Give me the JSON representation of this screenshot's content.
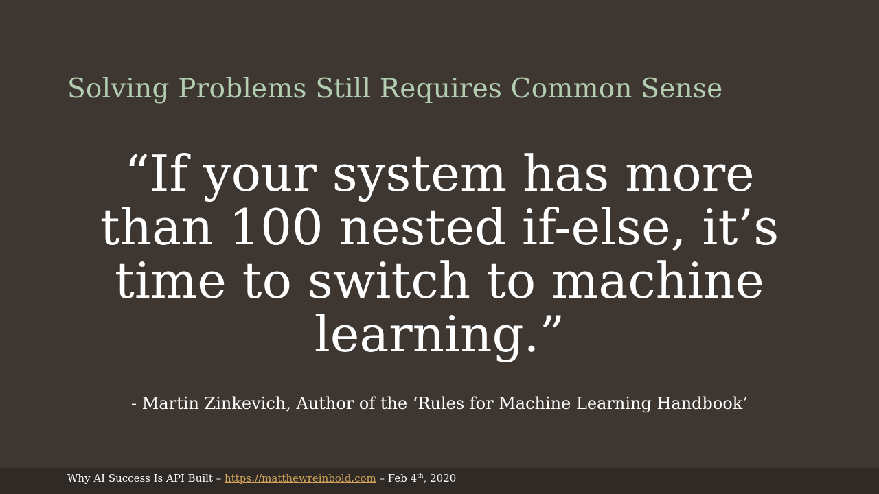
{
  "slide": {
    "title": "Solving Problems Still Requires Common Sense",
    "quote": "“If your system has more than 100 nested if-else, it’s time to switch to machine learning.”",
    "attribution": "- Martin Zinkevich, Author of the ‘Rules for Machine Learning Handbook’"
  },
  "footer": {
    "prefix": "Why AI Success  Is API Built – ",
    "link_text": "https://matthewreinbold.com",
    "date_prefix": "  – Feb 4",
    "date_suffix": "th",
    "year": ", 2020"
  },
  "colors": {
    "background": "#3e3731",
    "title": "#b2cdb0",
    "text": "#ffffff",
    "link": "#d2a45a",
    "footer_band": "#2f2a25"
  }
}
